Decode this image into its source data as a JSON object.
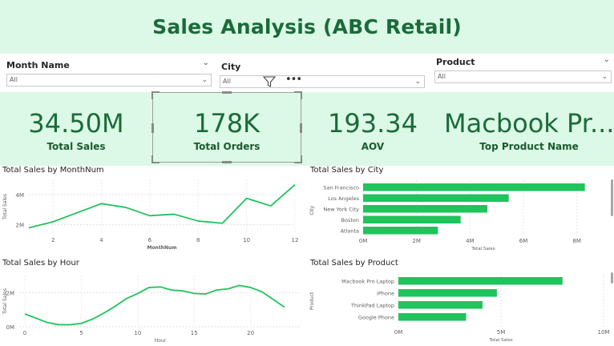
{
  "header": {
    "title": "Sales Analysis (ABC Retail)"
  },
  "slicers": {
    "month": {
      "label": "Month Name",
      "value": "All"
    },
    "city": {
      "label": "City",
      "value": "All"
    },
    "product": {
      "label": "Product",
      "value": "All"
    }
  },
  "icons": {
    "filter": "filter-icon",
    "more": "more-options-icon",
    "chevron": "chevron-down-icon"
  },
  "kpis": [
    {
      "value": "34.50M",
      "label": "Total Sales"
    },
    {
      "value": "178K",
      "label": "Total Orders"
    },
    {
      "value": "193.34",
      "label": "AOV"
    },
    {
      "value": "Macbook Pr...",
      "label": "Top Product Name"
    }
  ],
  "colors": {
    "accent": "#21c35c",
    "band": "#dcf8e6",
    "title": "#1a6b3a"
  },
  "chart_data": [
    {
      "id": "month",
      "type": "line",
      "title": "Total Sales by MonthNum",
      "xlabel": "MonthNum",
      "ylabel": "Total Sales",
      "x": [
        1,
        2,
        3,
        4,
        5,
        6,
        7,
        8,
        9,
        10,
        11,
        12
      ],
      "series": [
        {
          "values": [
            1.8,
            2.2,
            2.8,
            3.4,
            3.15,
            2.6,
            2.7,
            2.25,
            2.1,
            3.75,
            3.25,
            4.65
          ]
        }
      ],
      "xticks": [
        2,
        4,
        6,
        8,
        10,
        12
      ],
      "yticks": [
        {
          "v": 2,
          "label": "2M"
        },
        {
          "v": 4,
          "label": "4M"
        }
      ],
      "xlim": [
        1,
        12
      ],
      "ylim": [
        1.4,
        5.0
      ],
      "grid": true
    },
    {
      "id": "city",
      "type": "bar",
      "orientation": "horizontal",
      "title": "Total Sales by City",
      "xlabel": "Total Sales",
      "ylabel": "City",
      "categories": [
        "San Francisco",
        "Los Angeles",
        "New York City",
        "Boston",
        "Atlanta"
      ],
      "values": [
        8.3,
        5.45,
        4.65,
        3.65,
        2.8
      ],
      "xticks": [
        {
          "v": 0,
          "label": "0M"
        },
        {
          "v": 2,
          "label": "2M"
        },
        {
          "v": 4,
          "label": "4M"
        },
        {
          "v": 6,
          "label": "6M"
        },
        {
          "v": 8,
          "label": "8M"
        }
      ],
      "xlim": [
        0,
        9
      ],
      "grid": true
    },
    {
      "id": "hour",
      "type": "line",
      "title": "Total Sales by Hour",
      "xlabel": "Hour",
      "ylabel": "Total Sales",
      "x": [
        0,
        1,
        2,
        3,
        4,
        5,
        6,
        7,
        8,
        9,
        10,
        11,
        12,
        13,
        14,
        15,
        16,
        17,
        18,
        19,
        20,
        21,
        22,
        23
      ],
      "series": [
        {
          "values": [
            0.75,
            0.5,
            0.25,
            0.12,
            0.12,
            0.2,
            0.45,
            0.8,
            1.2,
            1.65,
            1.95,
            2.3,
            2.33,
            2.15,
            2.1,
            1.95,
            1.92,
            2.15,
            2.22,
            2.42,
            2.3,
            2.05,
            1.6,
            1.15
          ]
        }
      ],
      "xticks": [
        0,
        5,
        10,
        15,
        20
      ],
      "yticks": [
        {
          "v": 0,
          "label": "0M"
        },
        {
          "v": 2,
          "label": "2M"
        }
      ],
      "xlim": [
        -0.5,
        24.5
      ],
      "ylim": [
        0,
        3.0
      ],
      "grid": true
    },
    {
      "id": "product",
      "type": "bar",
      "orientation": "horizontal",
      "title": "Total Sales by Product",
      "xlabel": "Total Sales",
      "ylabel": "Product",
      "categories": [
        "Macbook Pro Laptop",
        "iPhone",
        "ThinkPad Laptop",
        "Google Phone"
      ],
      "values": [
        8.0,
        4.8,
        4.1,
        3.3
      ],
      "xticks": [
        {
          "v": 0,
          "label": "0M"
        },
        {
          "v": 5,
          "label": "5M"
        },
        {
          "v": 10,
          "label": "10M"
        }
      ],
      "xlim": [
        0,
        10
      ],
      "grid": true
    }
  ]
}
